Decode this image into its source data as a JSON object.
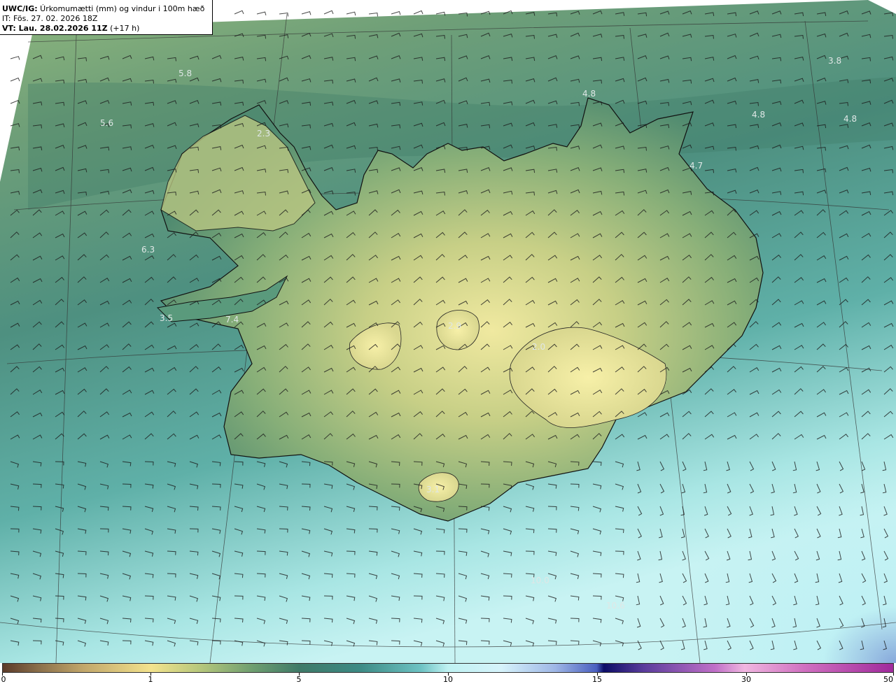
{
  "header": {
    "model_bold": "UWC/IG:",
    "title_rest": " Úrkomumætti (mm) og vindur i 100m hæð",
    "init_time": "IT: Fös. 27. 02. 2026 18Z",
    "valid_bold": "VT: Lau. 28.02.2026 11Z",
    "valid_lead": " (+17 h)"
  },
  "map": {
    "subject": "Iceland",
    "field": "Precipitable water (mm)",
    "overlay": "Wind barbs at 100m",
    "colors": {
      "ocean_south": "#9fe0e0",
      "ocean_mid": "#4f9f8f",
      "ocean_north": "#7aa878",
      "land_low": "#4e8d74",
      "land_high": "#e8e394",
      "coastline": "#111111",
      "grid": "#333333"
    }
  },
  "value_labels": [
    {
      "text": "5.8"
    },
    {
      "text": "5.6"
    },
    {
      "text": "4.8"
    },
    {
      "text": "4.8"
    },
    {
      "text": "4.8"
    },
    {
      "text": "3.8"
    },
    {
      "text": "4.7"
    },
    {
      "text": "6.3"
    },
    {
      "text": "3.5"
    },
    {
      "text": "7.4"
    },
    {
      "text": "3.1"
    },
    {
      "text": "10.0"
    },
    {
      "text": "10.6"
    },
    {
      "text": "2.3"
    },
    {
      "text": "2.9"
    },
    {
      "text": "2.0"
    }
  ],
  "legend": {
    "ticks": [
      "0",
      "1",
      "5",
      "10",
      "15",
      "30",
      "50"
    ]
  }
}
